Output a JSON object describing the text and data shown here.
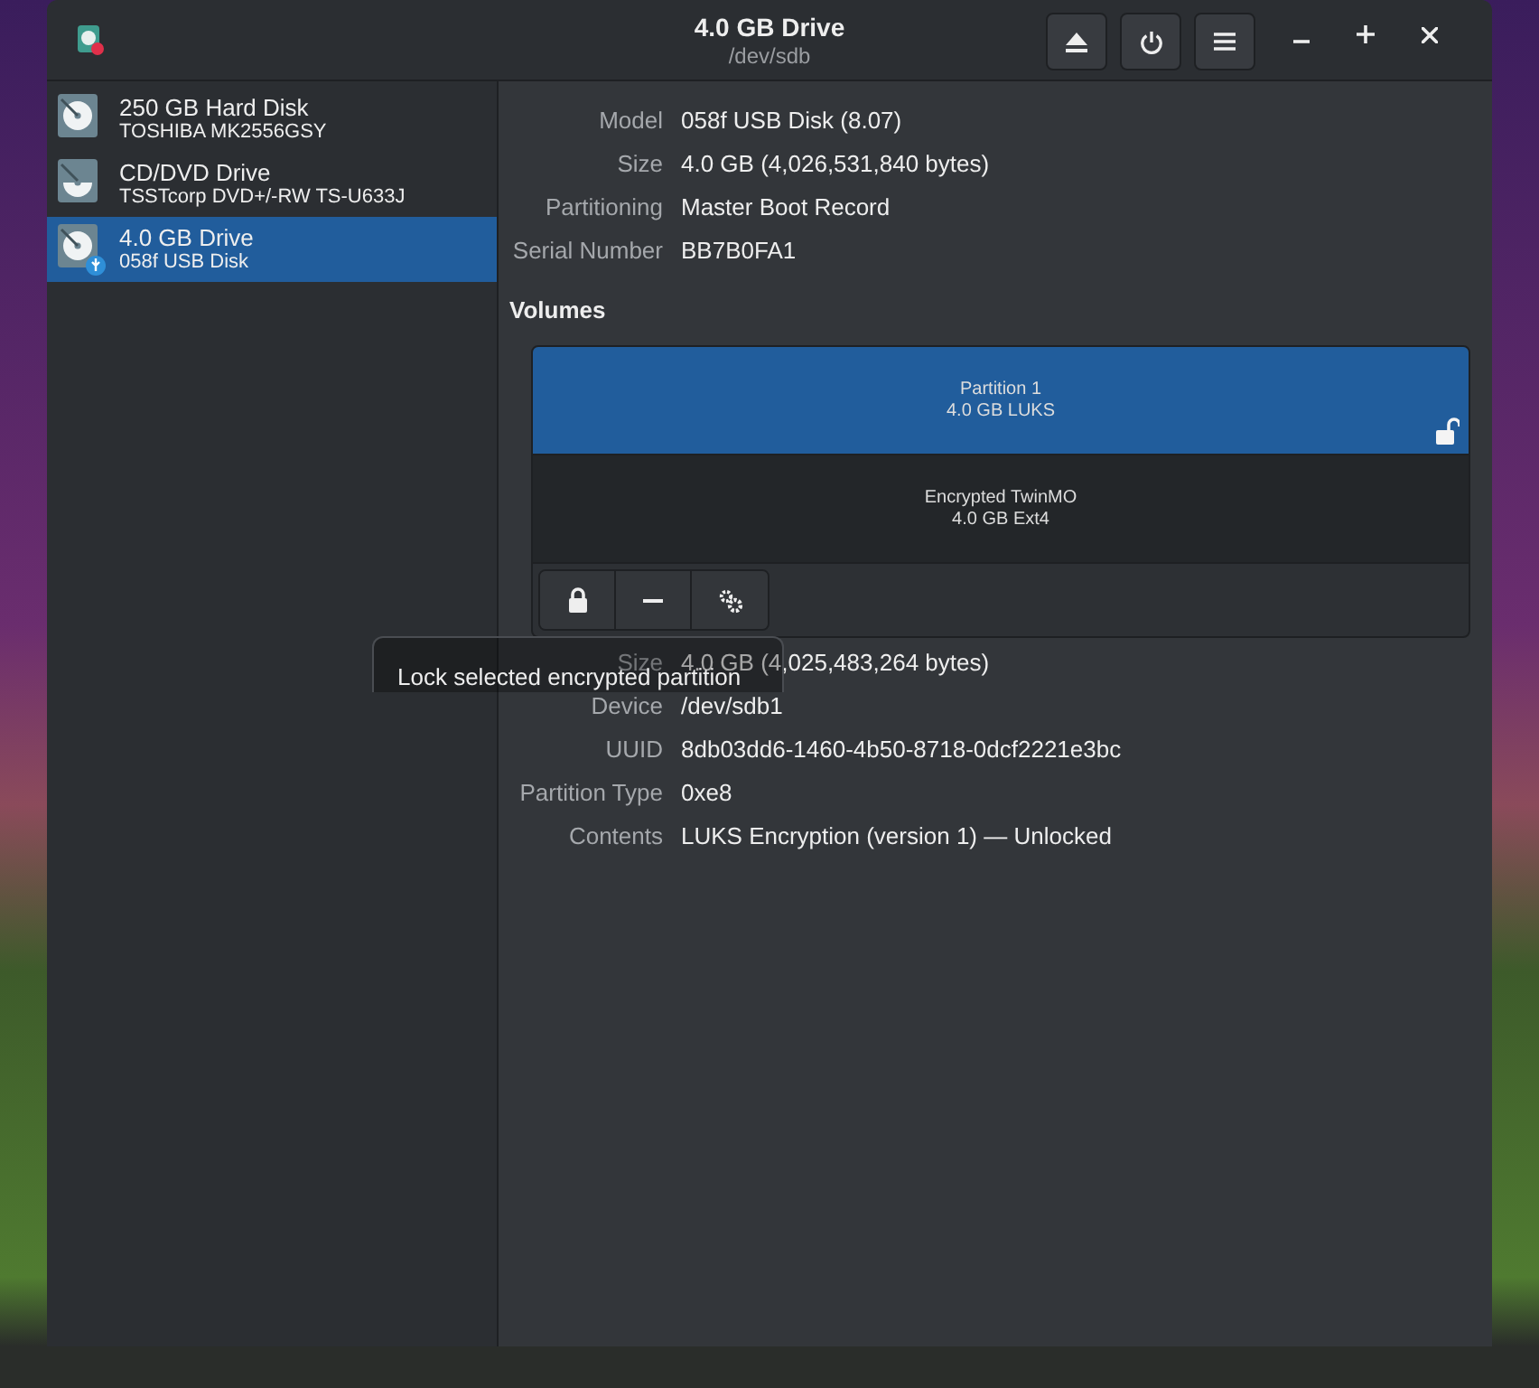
{
  "window": {
    "title": "4.0 GB Drive",
    "subtitle": "/dev/sdb"
  },
  "sidebar": {
    "items": [
      {
        "name": "250 GB Hard Disk",
        "detail": "TOSHIBA MK2556GSY",
        "kind": "disk",
        "selected": false
      },
      {
        "name": "CD/DVD Drive",
        "detail": "TSSTcorp DVD+/-RW TS-U633J",
        "kind": "optical",
        "selected": false
      },
      {
        "name": "4.0 GB Drive",
        "detail": "058f USB Disk",
        "kind": "usb",
        "selected": true
      }
    ]
  },
  "drive_info": [
    {
      "label": "Model",
      "value": "058f USB Disk (8.07)"
    },
    {
      "label": "Size",
      "value": "4.0 GB (4,026,531,840 bytes)"
    },
    {
      "label": "Partitioning",
      "value": "Master Boot Record"
    },
    {
      "label": "Serial Number",
      "value": "BB7B0FA1"
    }
  ],
  "volumes": {
    "title": "Volumes",
    "partitions": [
      {
        "name": "Partition 1",
        "detail": "4.0 GB LUKS",
        "selected": true,
        "unlocked": true
      },
      {
        "name": "Encrypted TwinMO",
        "detail": "4.0 GB Ext4",
        "selected": false,
        "unlocked": false
      }
    ]
  },
  "tooltip": {
    "text": "Lock selected encrypted partition"
  },
  "volume_info": [
    {
      "label": "Size",
      "value": "4.0 GB (4,025,483,264 bytes)"
    },
    {
      "label": "Device",
      "value": "/dev/sdb1"
    },
    {
      "label": "UUID",
      "value": "8db03dd6-1460-4b50-8718-0dcf2221e3bc"
    },
    {
      "label": "Partition Type",
      "value": "0xe8"
    },
    {
      "label": "Contents",
      "value": "LUKS Encryption (version 1) — Unlocked"
    }
  ]
}
